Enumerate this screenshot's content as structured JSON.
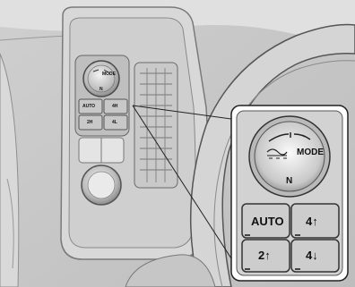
{
  "small_panel": {
    "mode_label": "MODE",
    "neutral_label": "N",
    "buttons": {
      "auto": "AUTO",
      "four_high": "4H",
      "two_high": "2H",
      "four_low": "4L"
    }
  },
  "zoom_panel": {
    "mode_label": "MODE",
    "neutral_label": "N",
    "buttons": {
      "auto": "AUTO",
      "four_high": "4↑",
      "two_high": "2↑",
      "four_low": "4↓"
    }
  }
}
